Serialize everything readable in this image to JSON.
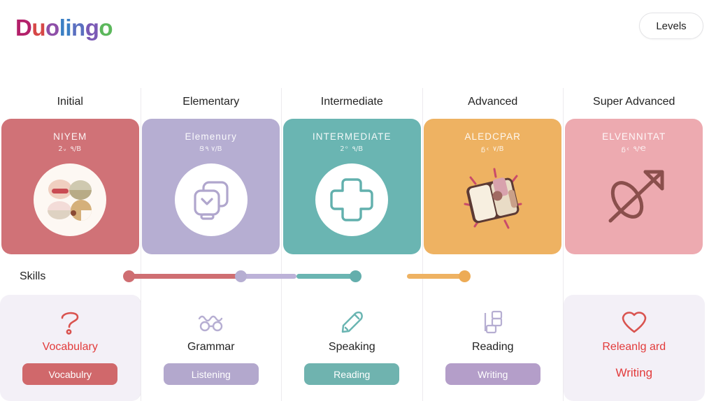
{
  "header": {
    "logo_text": "Duolingo",
    "logo_letters": [
      {
        "ch": "D",
        "color": "#b3206a"
      },
      {
        "ch": "u",
        "color": "#d64747"
      },
      {
        "ch": "o",
        "color": "#8e4fa8"
      },
      {
        "ch": "l",
        "color": "#3b7fc4"
      },
      {
        "ch": "i",
        "color": "#3b7fc4"
      },
      {
        "ch": "n",
        "color": "#5a6fc0"
      },
      {
        "ch": "g",
        "color": "#7a59b5"
      },
      {
        "ch": "o",
        "color": "#5cb85c"
      }
    ],
    "levels_button": "Levels"
  },
  "levels": [
    {
      "column_title": "Initial",
      "card_title": "NIYEM",
      "card_subtitle": "2ᵥ ٩/B",
      "card_color": "#d07277",
      "icon": "food-plate-icon"
    },
    {
      "column_title": "Elementary",
      "card_title": "Elemenury",
      "card_subtitle": "Ց٧ ٩/B",
      "card_color": "#b6aed2",
      "icon": "layered-window-chevron-icon"
    },
    {
      "column_title": "Intermediate",
      "card_title": "INTERMEDIATE",
      "card_subtitle": "2ᵒ ٩/B",
      "card_color": "#6ab5b2",
      "icon": "plus-cross-icon"
    },
    {
      "column_title": "Advanced",
      "card_title": "ALEDCPAR",
      "card_subtitle": "ᵷ‹ ٧/B",
      "card_color": "#eeb262",
      "icon": "open-book-sparkle-icon"
    },
    {
      "column_title": "Super Advanced",
      "card_title": "ELVENNITAT",
      "card_subtitle": "ᵷ‹ ٩/Ҽ",
      "card_color": "#edaab0",
      "icon": "arrow-through-ring-icon"
    }
  ],
  "slider": {
    "label": "Skills",
    "segments": [
      {
        "name": "initial",
        "color": "#cf6e72",
        "start_pct": 10.0,
        "end_pct": 30.0
      },
      {
        "name": "elementary",
        "color": "#bcb2d8",
        "start_pct": 30.0,
        "end_pct": 40.0
      },
      {
        "name": "intermediate",
        "color": "#6ab5b2",
        "start_pct": 40.0,
        "end_pct": 50.5
      },
      {
        "name": "advanced",
        "color": "#eeb262",
        "start_pct": 59.8,
        "end_pct": 70.1
      }
    ],
    "knobs": [
      {
        "name": "initial-knob",
        "color": "#cf6e72",
        "pct": 10.0
      },
      {
        "name": "elementary-knob",
        "color": "#b6aed2",
        "pct": 30.0
      },
      {
        "name": "intermediate-knob",
        "color": "#63aeac",
        "pct": 50.5
      },
      {
        "name": "advanced-knob",
        "color": "#edab55",
        "pct": 70.1
      }
    ]
  },
  "skills": [
    {
      "name": "Vocabulary",
      "icon": "question-mark-icon",
      "icon_color": "#d9534f",
      "name_color": "red",
      "tinted": true,
      "pill": {
        "label": "Vocabulry",
        "color": "#d0686b"
      }
    },
    {
      "name": "Grammar",
      "icon": "glasses-icon",
      "icon_color": "#b6aed2",
      "name_color": "dark",
      "tinted": false,
      "pill": {
        "label": "Listening",
        "color": "#b3a8cd"
      }
    },
    {
      "name": "Speaking",
      "icon": "pen-nib-icon",
      "icon_color": "#6ab5b2",
      "name_color": "dark",
      "tinted": false,
      "pill": {
        "label": "Reading",
        "color": "#6fb3af"
      }
    },
    {
      "name": "Reading",
      "icon": "blocks-stack-icon",
      "icon_color": "#b6aed2",
      "name_color": "dark",
      "tinted": false,
      "pill": {
        "label": "Writing",
        "color": "#b49ec9"
      }
    },
    {
      "name": "Releanlg ard",
      "icon": "heart-icon",
      "icon_color": "#d9534f",
      "name_color": "red",
      "tinted": true,
      "plain_text": "Writing"
    }
  ]
}
